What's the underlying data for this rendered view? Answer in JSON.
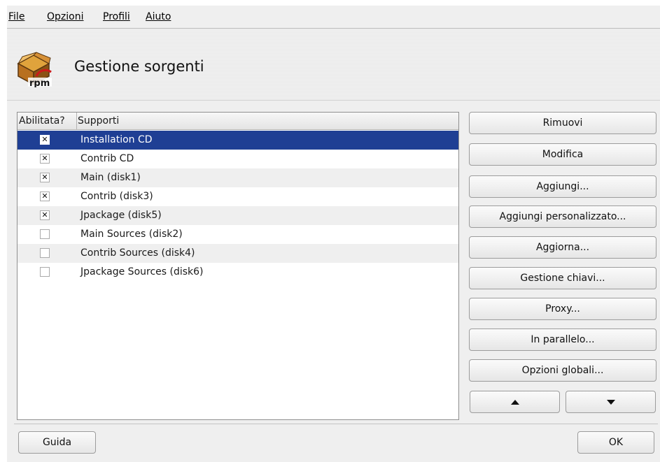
{
  "menubar": {
    "items": [
      {
        "label": "File"
      },
      {
        "label": "Opzioni"
      },
      {
        "label": "Profili"
      },
      {
        "label": "Aiuto"
      }
    ]
  },
  "header": {
    "logo_icon": "rpm-box-icon",
    "title": "Gestione sorgenti"
  },
  "media_list": {
    "columns": [
      "Abilitata?",
      "Supporti"
    ],
    "rows": [
      {
        "enabled": true,
        "check": "✕",
        "name": "Installation CD",
        "selected": true
      },
      {
        "enabled": true,
        "check": "✕",
        "name": "Contrib CD",
        "selected": false
      },
      {
        "enabled": true,
        "check": "✕",
        "name": "Main (disk1)",
        "selected": false
      },
      {
        "enabled": true,
        "check": "✕",
        "name": "Contrib (disk3)",
        "selected": false
      },
      {
        "enabled": true,
        "check": "✕",
        "name": "Jpackage (disk5)",
        "selected": false
      },
      {
        "enabled": false,
        "check": "",
        "name": "Main Sources (disk2)",
        "selected": false
      },
      {
        "enabled": false,
        "check": "",
        "name": "Contrib Sources (disk4)",
        "selected": false
      },
      {
        "enabled": false,
        "check": "",
        "name": "Jpackage Sources (disk6)",
        "selected": false
      }
    ]
  },
  "actions": {
    "remove": "Rimuovi",
    "edit": "Modifica",
    "add": "Aggiungi...",
    "add_custom": "Aggiungi personalizzato...",
    "update": "Aggiorna...",
    "manage_keys": "Gestione chiavi...",
    "proxy": "Proxy...",
    "parallel": "In parallelo...",
    "global_options": "Opzioni globali...",
    "move_up_icon": "triangle-up-icon",
    "move_down_icon": "triangle-down-icon"
  },
  "footer": {
    "help": "Guida",
    "ok": "OK"
  },
  "colors": {
    "selection": "#1f3f94",
    "window_bg": "#efefef"
  }
}
